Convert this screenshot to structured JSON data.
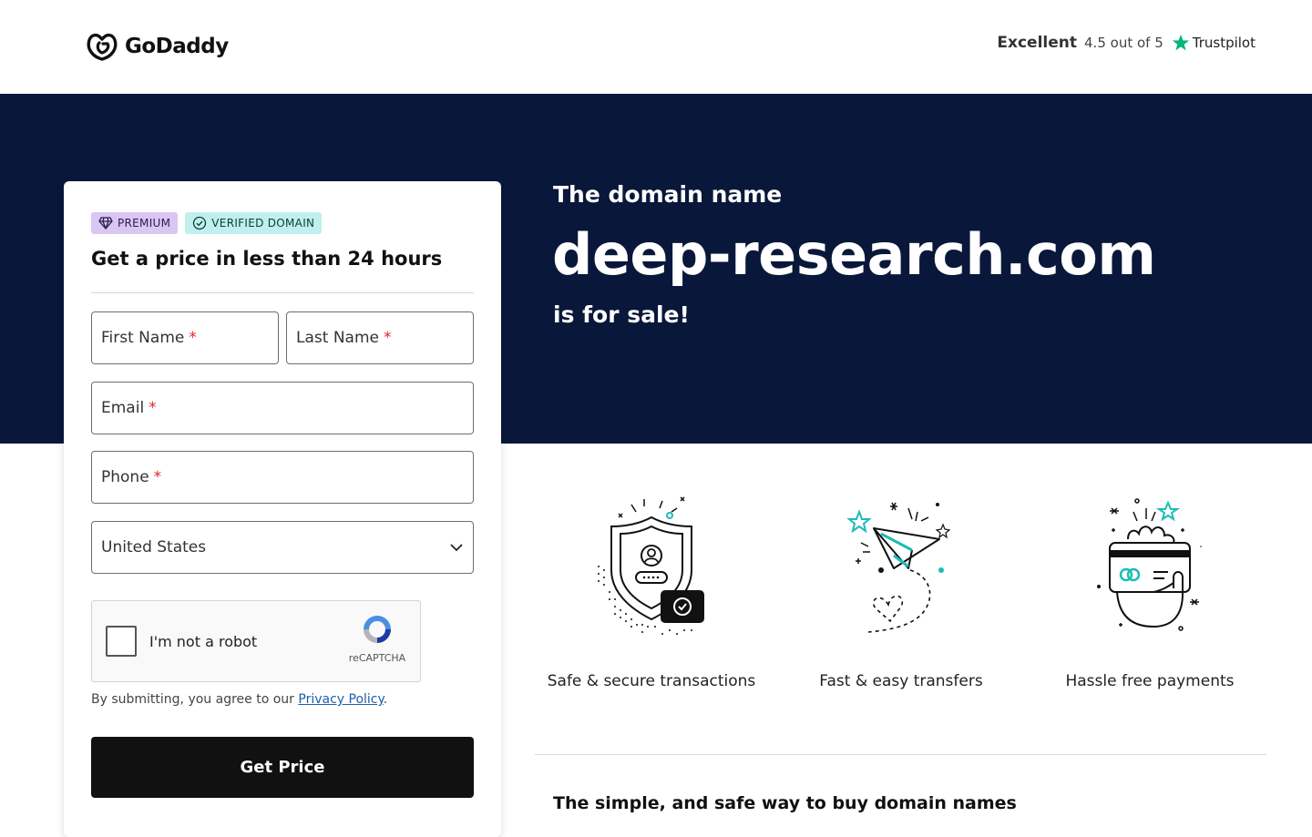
{
  "header": {
    "logo_text": "GoDaddy",
    "trust_rating_word": "Excellent",
    "trust_score": "4.5 out of 5",
    "trust_brand": "Trustpilot"
  },
  "hero": {
    "pre": "The domain name",
    "domain": "deep-research.com",
    "post": "is for sale!"
  },
  "form": {
    "badge_premium": "PREMIUM",
    "badge_verified": "VERIFIED DOMAIN",
    "title": "Get a price in less than 24 hours",
    "first_name": "First Name",
    "last_name": "Last Name",
    "email": "Email",
    "phone": "Phone",
    "required_marker": "*",
    "country": "United States",
    "captcha_label": "I'm not a robot",
    "captcha_brand": "reCAPTCHA",
    "agree_prefix": "By submitting, you agree to our",
    "privacy_link": "Privacy Policy",
    "agree_suffix": ".",
    "submit": "Get Price"
  },
  "features": [
    {
      "label": "Safe & secure transactions",
      "icon": "shield-icon"
    },
    {
      "label": "Fast & easy transfers",
      "icon": "paper-plane-icon"
    },
    {
      "label": "Hassle free payments",
      "icon": "card-payment-icon"
    }
  ],
  "bottom": {
    "title": "The simple, and safe way to buy domain names"
  },
  "colors": {
    "hero_bg": "#09173a",
    "accent_teal": "#1bbcb8",
    "trustpilot_green": "#00b67a",
    "required_red": "#d9282f"
  }
}
